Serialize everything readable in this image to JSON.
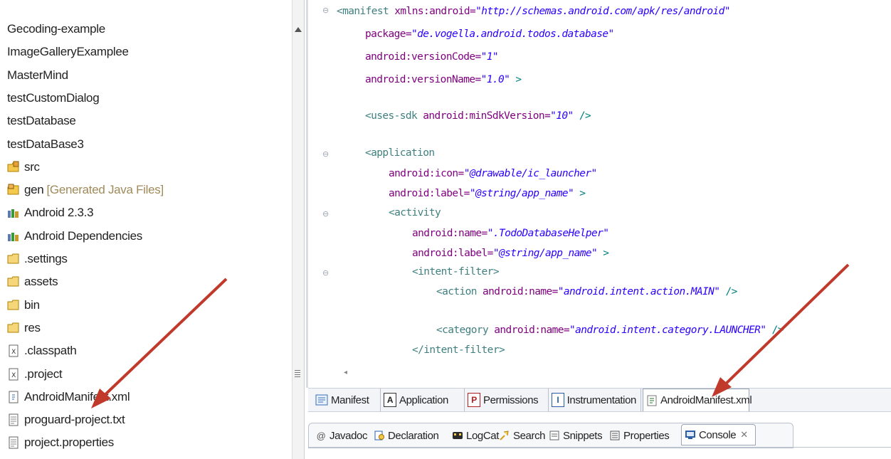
{
  "explorer": {
    "items": [
      {
        "label": "Gecoding-example",
        "icon": "none"
      },
      {
        "label": "ImageGalleryExamplee",
        "icon": "none"
      },
      {
        "label": "MasterMind",
        "icon": "none"
      },
      {
        "label": "testCustomDialog",
        "icon": "none"
      },
      {
        "label": "testDatabase",
        "icon": "none"
      },
      {
        "label": "testDataBase3",
        "icon": "none"
      },
      {
        "label": "src",
        "icon": "source-folder-icon"
      },
      {
        "label": "gen",
        "sub": "[Generated Java Files]",
        "icon": "generated-folder-icon"
      },
      {
        "label": "Android 2.3.3",
        "icon": "library-icon"
      },
      {
        "label": "Android Dependencies",
        "icon": "library-icon"
      },
      {
        "label": ".settings",
        "icon": "folder-icon"
      },
      {
        "label": "assets",
        "icon": "folder-icon"
      },
      {
        "label": "bin",
        "icon": "folder-icon"
      },
      {
        "label": "res",
        "icon": "folder-icon"
      },
      {
        "label": ".classpath",
        "icon": "xml-file-icon"
      },
      {
        "label": ".project",
        "icon": "xml-file-icon"
      },
      {
        "label": "AndroidManifest.xml",
        "icon": "manifest-file-icon"
      },
      {
        "label": "proguard-project.txt",
        "icon": "text-file-icon"
      },
      {
        "label": "project.properties",
        "icon": "text-file-icon"
      }
    ]
  },
  "editor": {
    "lines": {
      "l1_tag": "<manifest",
      "l1_attr": " xmlns:android=",
      "l1_val": "\"http://schemas.android.com/apk/res/android\"",
      "l2_attr": "package=",
      "l2_val": "\"de.vogella.android.todos.database\"",
      "l3_attr": "android:versionCode=",
      "l3_val": "\"1\"",
      "l4_attr": "android:versionName=",
      "l4_val": "\"1.0\"",
      "l4_end": " >",
      "l5_tag": "<uses-sdk",
      "l5_attr": " android:minSdkVersion=",
      "l5_val": "\"10\"",
      "l5_end": " />",
      "l6_tag": "<application",
      "l7_attr": "android:icon=",
      "l7_val": "\"@drawable/ic_launcher\"",
      "l8_attr": "android:label=",
      "l8_val": "\"@string/app_name\"",
      "l8_end": " >",
      "l9_tag": "<activity",
      "l10_attr": "android:name=",
      "l10_val": "\".TodoDatabaseHelper\"",
      "l11_attr": "android:label=",
      "l11_val": "\"@string/app_name\"",
      "l11_end": " >",
      "l12_tag": "<intent-filter>",
      "l13_tag": "<action",
      "l13_attr": " android:name=",
      "l13_val": "\"android.intent.action.MAIN\"",
      "l13_end": " />",
      "l14_tag": "<category",
      "l14_attr": " android:name=",
      "l14_val": "\"android.intent.category.LAUNCHER\"",
      "l14_end": " />",
      "l15_tag": "</intent-filter>"
    }
  },
  "editor_tabs": {
    "manifest": "Manifest",
    "application": "Application",
    "permissions": "Permissions",
    "instrumentation": "Instrumentation",
    "xml": "AndroidManifest.xml",
    "application_glyph": "A",
    "permissions_glyph": "P",
    "instrumentation_glyph": "I"
  },
  "views": {
    "javadoc": "Javadoc",
    "declaration": "Declaration",
    "logcat": "LogCat",
    "search": "Search",
    "snippets": "Snippets",
    "properties": "Properties",
    "console": "Console"
  },
  "colors": {
    "annotation_arrow": "#c0392b",
    "xml_tag": "#3f7f7f",
    "xml_attr": "#7f007f",
    "xml_value": "#2a00ff"
  }
}
